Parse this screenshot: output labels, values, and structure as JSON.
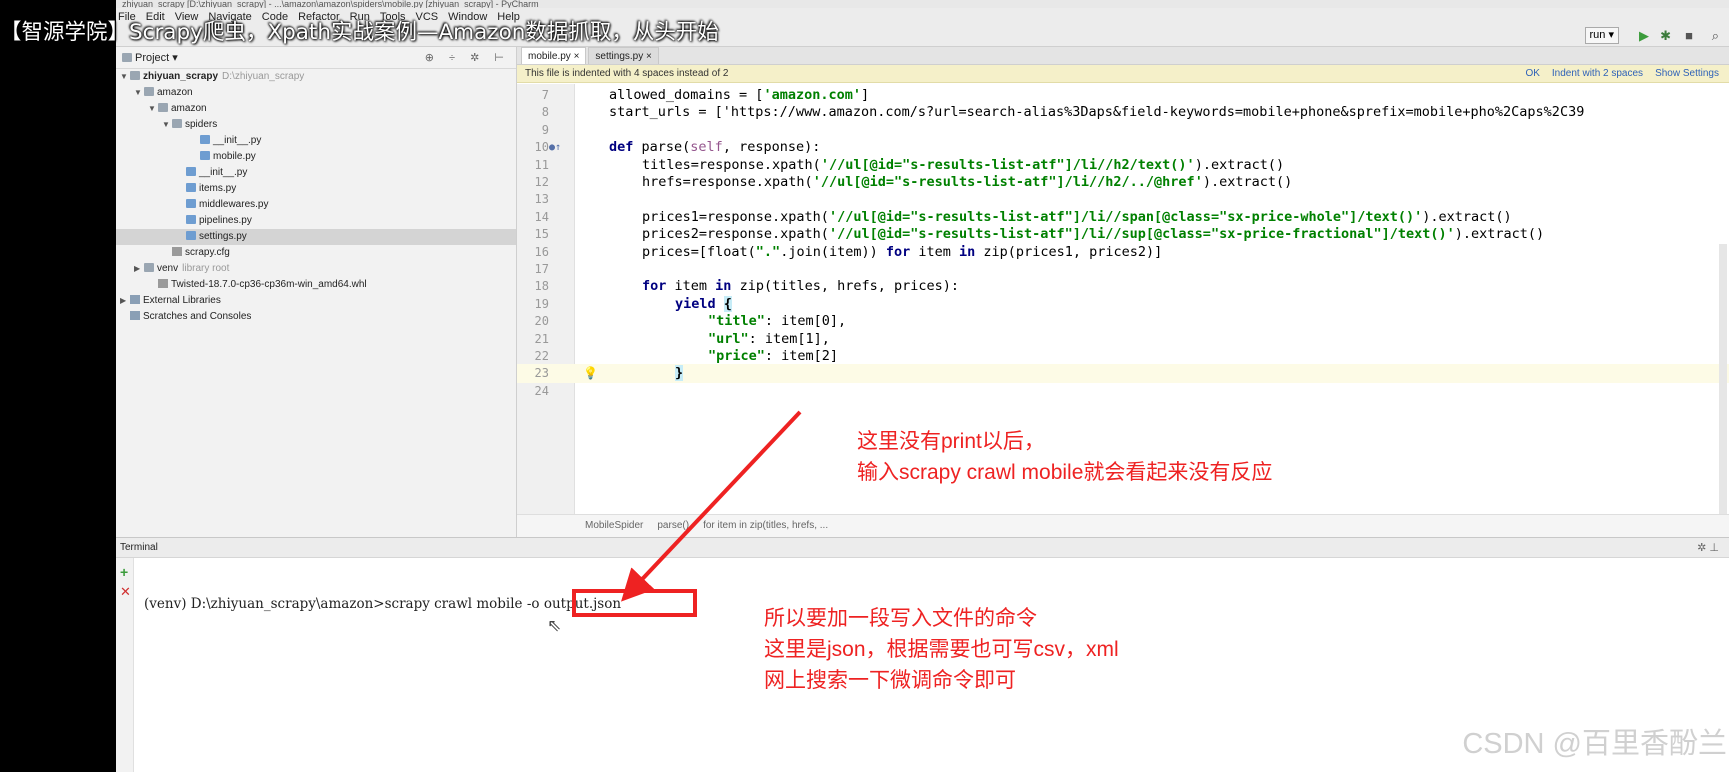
{
  "overlay": {
    "video_title": "【智源学院】Scrapy爬虫，Xpath实战案例—Amazon数据抓取，从头开始",
    "annotation_1": [
      "这里没有print以后，",
      "输入scrapy crawl mobile就会看起来没有反应"
    ],
    "annotation_2": [
      "所以要加一段写入文件的命令",
      "这里是json，根据需要也可写csv，xml",
      "网上搜索一下微调命令即可"
    ],
    "watermark": "CSDN @百里香酚兰",
    "accent_color": "#ee2222"
  },
  "window": {
    "title": "zhiyuan_scrapy [D:\\zhiyuan_scrapy] - ...\\amazon\\amazon\\spiders\\mobile.py [zhiyuan_scrapy] - PyCharm"
  },
  "menu": [
    "File",
    "Edit",
    "View",
    "Navigate",
    "Code",
    "Refactor",
    "Run",
    "Tools",
    "VCS",
    "Window",
    "Help"
  ],
  "toolbar": {
    "run_config": "run",
    "run_icon": "play-icon",
    "debug_icon": "bug-icon"
  },
  "project": {
    "header": "Project",
    "tree": [
      {
        "label": "zhiyuan_scrapy",
        "hint": "D:\\zhiyuan_scrapy",
        "icon": "folder",
        "depth": 0,
        "arrow": "v",
        "bold": true
      },
      {
        "label": "amazon",
        "hint": "",
        "icon": "folder",
        "depth": 1,
        "arrow": "v"
      },
      {
        "label": "amazon",
        "hint": "",
        "icon": "folder",
        "depth": 2,
        "arrow": "v"
      },
      {
        "label": "spiders",
        "hint": "",
        "icon": "folder",
        "depth": 3,
        "arrow": "v"
      },
      {
        "label": "__init__.py",
        "hint": "",
        "icon": "py",
        "depth": 5,
        "arrow": ""
      },
      {
        "label": "mobile.py",
        "hint": "",
        "icon": "py",
        "depth": 5,
        "arrow": ""
      },
      {
        "label": "__init__.py",
        "hint": "",
        "icon": "py",
        "depth": 4,
        "arrow": ""
      },
      {
        "label": "items.py",
        "hint": "",
        "icon": "py",
        "depth": 4,
        "arrow": ""
      },
      {
        "label": "middlewares.py",
        "hint": "",
        "icon": "py",
        "depth": 4,
        "arrow": ""
      },
      {
        "label": "pipelines.py",
        "hint": "",
        "icon": "py",
        "depth": 4,
        "arrow": ""
      },
      {
        "label": "settings.py",
        "hint": "",
        "icon": "py",
        "depth": 4,
        "arrow": "",
        "selected": true
      },
      {
        "label": "scrapy.cfg",
        "hint": "",
        "icon": "cfg",
        "depth": 3,
        "arrow": ""
      },
      {
        "label": "venv",
        "hint": "library root",
        "icon": "folder",
        "depth": 1,
        "arrow": ">"
      },
      {
        "label": "Twisted-18.7.0-cp36-cp36m-win_amd64.whl",
        "hint": "",
        "icon": "cfg",
        "depth": 2,
        "arrow": ""
      },
      {
        "label": "External Libraries",
        "hint": "",
        "icon": "lib",
        "depth": 0,
        "arrow": ">"
      },
      {
        "label": "Scratches and Consoles",
        "hint": "",
        "icon": "lib",
        "depth": 0,
        "arrow": ""
      }
    ]
  },
  "editor": {
    "tabs": [
      {
        "label": "mobile.py ×",
        "active": true
      },
      {
        "label": "settings.py ×",
        "active": false
      }
    ],
    "notice": "This file is indented with 4 spaces instead of 2",
    "notice_actions": [
      "OK",
      "Indent with 2 spaces",
      "Show Settings"
    ],
    "lines": [
      {
        "n": "7",
        "code": "allowed_domains = ['amazon.com']",
        "indent": 0
      },
      {
        "n": "8",
        "code": "start_urls = ['https://www.amazon.com/s?url=search-alias%3Daps&field-keywords=mobile+phone&sprefix=mobile+pho%2Caps%2C39",
        "indent": 0
      },
      {
        "n": "9",
        "code": "",
        "indent": 0
      },
      {
        "n": "10",
        "code": "def parse(self, response):",
        "indent": 0
      },
      {
        "n": "11",
        "code": "titles=response.xpath('//ul[@id=\"s-results-list-atf\"]/li//h2/text()').extract()",
        "indent": 1
      },
      {
        "n": "12",
        "code": "hrefs=response.xpath('//ul[@id=\"s-results-list-atf\"]/li//h2/../@href').extract()",
        "indent": 1
      },
      {
        "n": "13",
        "code": "",
        "indent": 0
      },
      {
        "n": "14",
        "code": "prices1=response.xpath('//ul[@id=\"s-results-list-atf\"]/li//span[@class=\"sx-price-whole\"]/text()').extract()",
        "indent": 1
      },
      {
        "n": "15",
        "code": "prices2=response.xpath('//ul[@id=\"s-results-list-atf\"]/li//sup[@class=\"sx-price-fractional\"]/text()').extract()",
        "indent": 1
      },
      {
        "n": "16",
        "code": "prices=[float(\".\".join(item)) for item in zip(prices1, prices2)]",
        "indent": 1
      },
      {
        "n": "17",
        "code": "",
        "indent": 0
      },
      {
        "n": "18",
        "code": "for item in zip(titles, hrefs, prices):",
        "indent": 1
      },
      {
        "n": "19",
        "code": "yield {",
        "indent": 2
      },
      {
        "n": "20",
        "code": "\"title\": item[0],",
        "indent": 3
      },
      {
        "n": "21",
        "code": "\"url\": item[1],",
        "indent": 3
      },
      {
        "n": "22",
        "code": "\"price\": item[2]",
        "indent": 3
      },
      {
        "n": "23",
        "code": "}",
        "indent": 2,
        "current": true
      },
      {
        "n": "24",
        "code": "",
        "indent": 0
      }
    ],
    "breadcrumb": [
      "MobileSpider",
      "parse()",
      "for item in zip(titles, hrefs, ..."
    ]
  },
  "terminal": {
    "header": "Terminal",
    "prompt": "(venv) D:\\zhiyuan_scrapy\\amazon>scrapy crawl mobile -o output.json"
  }
}
